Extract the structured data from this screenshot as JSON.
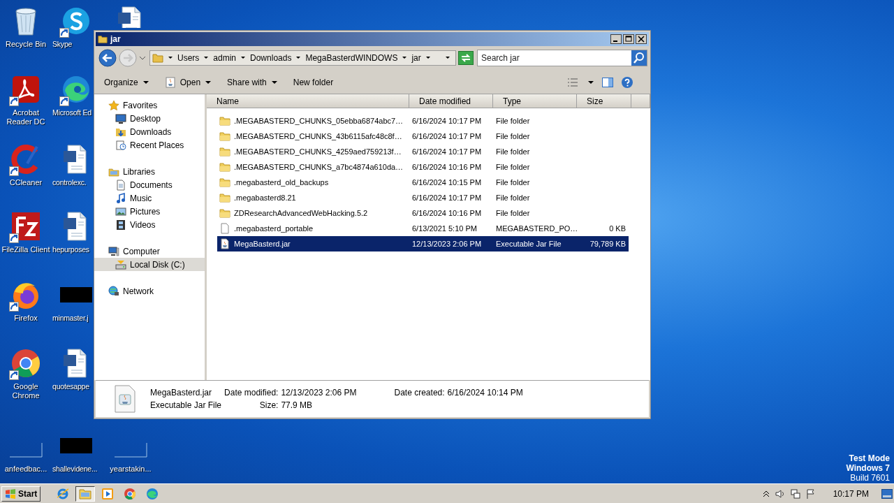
{
  "desktop": {
    "rows": [
      [
        {
          "label": "Recycle Bin",
          "kind": "bin",
          "shortcut": false
        },
        {
          "label": "Skype",
          "kind": "skype",
          "shortcut": true
        },
        {
          "kind": "document",
          "shortcut": false
        }
      ],
      [
        {
          "label": "Acrobat Reader DC",
          "kind": "acrobat",
          "shortcut": true
        },
        {
          "label": "Microsoft Ed",
          "kind": "edge",
          "shortcut": true
        }
      ],
      [
        {
          "label": "CCleaner",
          "kind": "ccleaner",
          "shortcut": true
        },
        {
          "label": "controlexc.",
          "kind": "document",
          "shortcut": false
        }
      ],
      [
        {
          "label": "FileZilla Client",
          "kind": "filezilla",
          "shortcut": true
        },
        {
          "label": "hepurposes",
          "kind": "document",
          "shortcut": false
        }
      ],
      [
        {
          "label": "Firefox",
          "kind": "firefox",
          "shortcut": true
        },
        {
          "label": "minmaster.j",
          "kind": "hidden",
          "shortcut": false
        }
      ],
      [
        {
          "label": "Google Chrome",
          "kind": "chrome",
          "shortcut": true
        },
        {
          "label": "quotesappe",
          "kind": "document",
          "shortcut": false
        }
      ],
      [
        {
          "label": "anfeedbac...",
          "kind": "blank",
          "shortcut": false
        },
        {
          "label": "shallevidene...",
          "kind": "hidden",
          "shortcut": false
        },
        {
          "label": "yearstakin...",
          "kind": "blank",
          "shortcut": false
        }
      ]
    ],
    "watermark": [
      "Test Mode",
      "Windows 7",
      "Build 7601"
    ]
  },
  "window": {
    "title": "jar",
    "address": {
      "crumbs": [
        "Users",
        "admin",
        "Downloads",
        "MegaBasterdWINDOWS",
        "jar"
      ]
    },
    "search": {
      "placeholder": "Search jar"
    },
    "toolbar": [
      {
        "label": "Organize",
        "kind": "menu"
      },
      {
        "label": "Open",
        "kind": "open"
      },
      {
        "label": "Share with",
        "kind": "menu"
      },
      {
        "label": "New folder",
        "kind": "plain"
      }
    ],
    "navigation": [
      {
        "label": "Favorites",
        "kind": "star",
        "children": [
          {
            "label": "Desktop",
            "kind": "desktop",
            "selected": false
          },
          {
            "label": "Downloads",
            "kind": "downloads",
            "selected": false
          },
          {
            "label": "Recent Places",
            "kind": "recent",
            "selected": false
          }
        ]
      },
      {
        "label": "Libraries",
        "kind": "libraries",
        "children": [
          {
            "label": "Documents",
            "kind": "documents",
            "selected": false
          },
          {
            "label": "Music",
            "kind": "music",
            "selected": false
          },
          {
            "label": "Pictures",
            "kind": "pictures",
            "selected": false
          },
          {
            "label": "Videos",
            "kind": "videos",
            "selected": false
          }
        ]
      },
      {
        "label": "Computer",
        "kind": "computer",
        "children": [
          {
            "label": "Local Disk (C:)",
            "kind": "disk",
            "selected": true
          }
        ]
      },
      {
        "label": "Network",
        "kind": "network"
      }
    ],
    "table": {
      "columns": [
        "Name",
        "Date modified",
        "Type",
        "Size"
      ],
      "rows": [
        {
          "name": ".MEGABASTERD_CHUNKS_05ebba6874abc7…",
          "date": "6/16/2024 10:17 PM",
          "type": "File folder",
          "kind": "folder",
          "selected": false
        },
        {
          "name": ".MEGABASTERD_CHUNKS_43b6115afc48c8f…",
          "date": "6/16/2024 10:17 PM",
          "type": "File folder",
          "kind": "folder",
          "selected": false
        },
        {
          "name": ".MEGABASTERD_CHUNKS_4259aed759213f…",
          "date": "6/16/2024 10:17 PM",
          "type": "File folder",
          "kind": "folder",
          "selected": false
        },
        {
          "name": ".MEGABASTERD_CHUNKS_a7bc4874a610da…",
          "date": "6/16/2024 10:16 PM",
          "type": "File folder",
          "kind": "folder",
          "selected": false
        },
        {
          "name": ".megabasterd_old_backups",
          "date": "6/16/2024 10:15 PM",
          "type": "File folder",
          "kind": "folder",
          "selected": false
        },
        {
          "name": ".megabasterd8.21",
          "date": "6/16/2024 10:17 PM",
          "type": "File folder",
          "kind": "folder",
          "selected": false
        },
        {
          "name": "ZDResearchAdvancedWebHacking.5.2",
          "date": "6/16/2024 10:16 PM",
          "type": "File folder",
          "kind": "folder",
          "selected": false
        },
        {
          "name": ".megabasterd_portable",
          "date": "6/13/2021 5:10 PM",
          "type": "MEGABASTERD_PO…",
          "size": "0 KB",
          "kind": "file",
          "selected": false
        },
        {
          "name": "MegaBasterd.jar",
          "date": "12/13/2023 2:06 PM",
          "type": "Executable Jar File",
          "size": "79,789 KB",
          "kind": "jar",
          "selected": true
        }
      ]
    },
    "details": {
      "name": "MegaBasterd.jar",
      "type": "Executable Jar File",
      "fields": [
        {
          "label": "Date modified:",
          "value": "12/13/2023 2:06 PM"
        },
        {
          "label": "Date created:",
          "value": "6/16/2024 10:14 PM"
        },
        {
          "label": "Size:",
          "value": "77.9 MB"
        }
      ]
    }
  },
  "taskbar": {
    "start": "Start",
    "apps": [
      {
        "kind": "ie",
        "active": false
      },
      {
        "kind": "explorer",
        "active": true
      },
      {
        "kind": "media",
        "active": false
      },
      {
        "kind": "chrome",
        "active": false
      },
      {
        "kind": "edge",
        "active": false
      }
    ],
    "clock": "10:17 PM"
  }
}
